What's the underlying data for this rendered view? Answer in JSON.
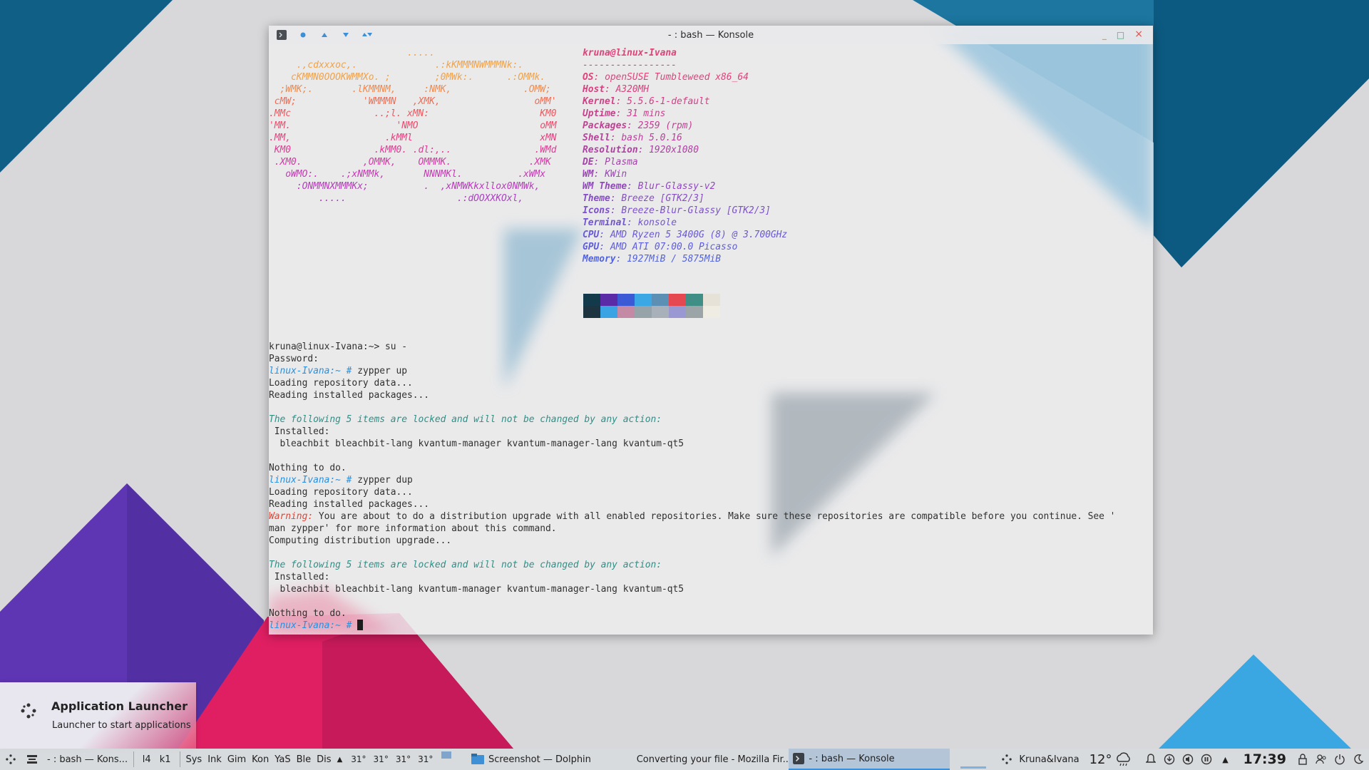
{
  "window": {
    "title": "- : bash — Konsole",
    "controls": {
      "minimize": "_",
      "maximize": "□",
      "close": "×"
    }
  },
  "neofetch": {
    "art_lines": [
      "                         .....",
      "     .,cdxxxoc,.              .:kKMMMNWMMMNk:.",
      "    cKMMN0OOOKWMMXo. ;        ;0MWk:.      .:OMMk.",
      "  ;WMK;.       .lKMMNM,     :NMK,             .OMW;",
      " cMW;            'WMMMN   ,XMK,                 oMM'",
      ".MMc               ..;l. xMN:                    KM0",
      "'MM.                   'NMO                      oMM",
      ".MM,                 .kMMl                       xMN",
      " KM0               .kMM0. .dl:,..               .WMd",
      " .XM0.           ,OMMK,    OMMMK.              .XMK",
      "   oWMO:.    .;xNMMk,       NNNMKl.          .xWMx",
      "     :ONMMNXMMMKx;          .  ,xNMWKkxllox0NMWk,",
      "         .....                    .:dOOXXKOxl,"
    ],
    "art_colors": [
      "#f0a24a",
      "#f0a24a",
      "#f0a24a",
      "#ef8a4e",
      "#f06c52",
      "#f0565d",
      "#ee4a6c",
      "#e6407d",
      "#dc3c92",
      "#d13aa4",
      "#c23bb2",
      "#b63dbb",
      "#ab40c4"
    ],
    "user_host": "kruna@linux-Ivana",
    "separator": "-----------------",
    "fields": [
      {
        "key": "OS",
        "value": "openSUSE Tumbleweed x86_64"
      },
      {
        "key": "Host",
        "value": "A320MH"
      },
      {
        "key": "Kernel",
        "value": "5.5.6-1-default"
      },
      {
        "key": "Uptime",
        "value": "31 mins"
      },
      {
        "key": "Packages",
        "value": "2359 (rpm)"
      },
      {
        "key": "Shell",
        "value": "bash 5.0.16"
      },
      {
        "key": "Resolution",
        "value": "1920x1080"
      },
      {
        "key": "DE",
        "value": "Plasma"
      },
      {
        "key": "WM",
        "value": "KWin"
      },
      {
        "key": "WM Theme",
        "value": "Blur-Glassy-v2"
      },
      {
        "key": "Theme",
        "value": "Breeze [GTK2/3]"
      },
      {
        "key": "Icons",
        "value": "Breeze-Blur-Glassy [GTK2/3]"
      },
      {
        "key": "Terminal",
        "value": "konsole"
      },
      {
        "key": "CPU",
        "value": "AMD Ryzen 5 3400G (8) @ 3.700GHz"
      },
      {
        "key": "GPU",
        "value": "AMD ATI 07:00.0 Picasso"
      },
      {
        "key": "Memory",
        "value": "1927MiB / 5875MiB"
      }
    ],
    "field_colors": [
      "#e0427a",
      "#d9407f",
      "#d24085",
      "#c9408c",
      "#c14093",
      "#b8419a",
      "#ae42a2",
      "#a444aa",
      "#9a46b3",
      "#9049bc",
      "#864cc4",
      "#7c50cb",
      "#7254d1",
      "#6858d6",
      "#5d5ddb",
      "#5263df"
    ],
    "palette_row1": [
      "#123a4a",
      "#5b2aa6",
      "#3d5ad6",
      "#3ba7e4",
      "#5b8fb3",
      "#e54850",
      "#3f8f86",
      "#e6e2d7"
    ],
    "palette_row2": [
      "#1d3440",
      "#3aa3e3",
      "#c48aa5",
      "#96a3a8",
      "#a8b1ba",
      "#9a98d2",
      "#9ba4a7",
      "#efece4"
    ]
  },
  "session": {
    "lines": [
      [
        {
          "t": "kruna@linux-Ivana:~> su -"
        }
      ],
      [
        {
          "t": "Password:"
        }
      ],
      [
        {
          "t": "linux-Ivana:~ # ",
          "c": "prompt"
        },
        {
          "t": "zypper up"
        }
      ],
      [
        {
          "t": "Loading repository data..."
        }
      ],
      [
        {
          "t": "Reading installed packages..."
        }
      ],
      [
        {
          "t": ""
        }
      ],
      [
        {
          "t": "The following 5 items are locked and will not be changed by any action:",
          "c": "locked"
        }
      ],
      [
        {
          "t": " Installed:"
        }
      ],
      [
        {
          "t": "  bleachbit bleachbit-lang kvantum-manager kvantum-manager-lang kvantum-qt5"
        }
      ],
      [
        {
          "t": ""
        }
      ],
      [
        {
          "t": "Nothing to do."
        }
      ],
      [
        {
          "t": "linux-Ivana:~ # ",
          "c": "prompt"
        },
        {
          "t": "zypper dup"
        }
      ],
      [
        {
          "t": "Loading repository data..."
        }
      ],
      [
        {
          "t": "Reading installed packages..."
        }
      ],
      [
        {
          "t": "Warning:",
          "c": "warn"
        },
        {
          "t": " You are about to do a distribution upgrade with all enabled repositories. Make sure these repositories are compatible before you continue. See '"
        }
      ],
      [
        {
          "t": "man zypper' for more information about this command."
        }
      ],
      [
        {
          "t": "Computing distribution upgrade..."
        }
      ],
      [
        {
          "t": ""
        }
      ],
      [
        {
          "t": "The following 5 items are locked and will not be changed by any action:",
          "c": "locked"
        }
      ],
      [
        {
          "t": " Installed:"
        }
      ],
      [
        {
          "t": "  bleachbit bleachbit-lang kvantum-manager kvantum-manager-lang kvantum-qt5"
        }
      ],
      [
        {
          "t": ""
        }
      ],
      [
        {
          "t": "Nothing to do."
        }
      ],
      [
        {
          "t": "linux-Ivana:~ # ",
          "c": "prompt"
        },
        {
          "cursor": true
        }
      ]
    ]
  },
  "launcher_tooltip": {
    "title": "Application Launcher",
    "subtitle": "Launcher to start applications"
  },
  "panel": {
    "konsole_task_short": "- : bash — Kons...",
    "desktops": [
      "l4",
      "k1"
    ],
    "quicklaunch": [
      "Sys",
      "Ink",
      "Gim",
      "Kon",
      "YaS",
      "Ble",
      "Dis"
    ],
    "temps": [
      "31°",
      "31°",
      "31°",
      "31°"
    ],
    "tasks": [
      {
        "label": "Screenshot — Dolphin",
        "icon": "folder-icon"
      },
      {
        "label": "Converting your file - Mozilla Fir...",
        "icon": "firefox-icon"
      },
      {
        "label": "- : bash — Konsole",
        "icon": "terminal-icon"
      }
    ],
    "user": "Kruna&Ivana",
    "weather_temp": "12°",
    "clock": "17:39"
  }
}
